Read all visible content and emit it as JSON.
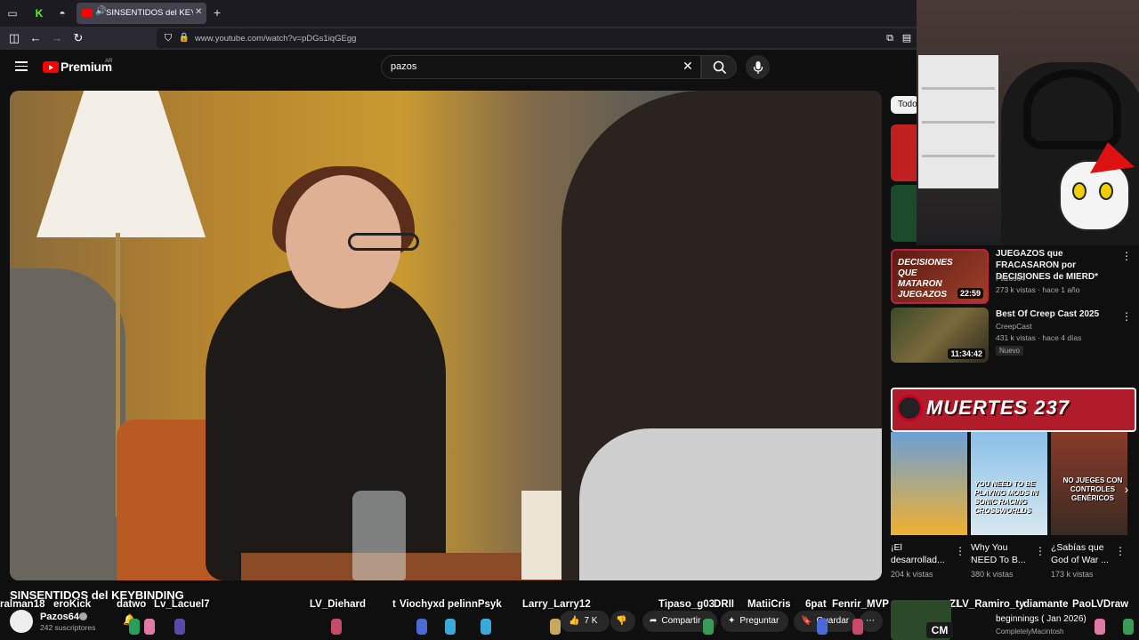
{
  "browser": {
    "active_tab_title": "SINSENTIDOS del KEYBINDING",
    "url": "www.youtube.com/watch?v=pDGs1iqGEgg"
  },
  "youtube": {
    "brand": "Premium",
    "region": "AR",
    "search_value": "pazos"
  },
  "video": {
    "title": "SINSENTIDOS del KEYBINDING",
    "channel": "Pazos64",
    "subscribers": "242 suscriptores",
    "likes": "7 K",
    "share_label": "Compartir",
    "ask_label": "Preguntar",
    "save_label": "Guardar"
  },
  "overlay_names": [
    "ralman18",
    "eroKick",
    "datwo",
    "Lv_Lacuel7",
    "LV_Diehard",
    "t",
    "Viochyxd",
    "pelinnPsyk",
    "Larry_Larry12",
    "Tipaso_g03",
    "DRII",
    "MatiiCris",
    "6pat",
    "Fenrir_MVP",
    "ZL",
    "LV_Ramiro_ty",
    "diamante",
    "PaoLVDraw"
  ],
  "sidebar": {
    "chip_label": "Todo",
    "recs": [
      {
        "title": "JUEGAZOS que FRACASARON por DECISIONES de MIERD*",
        "channel": "Pazos64",
        "meta": "273 k vistas · hace 1 año",
        "duration": "22:59",
        "thumb_text": "DECISIONES QUE MATARON JUEGAZOS"
      },
      {
        "title": "Best Of Creep Cast 2025",
        "channel": "CreepCast",
        "meta": "431 k vistas · hace 4 días",
        "duration": "11:34:42",
        "badge": "Nuevo"
      }
    ],
    "shelf": {
      "banner_text": "MUERTES 237",
      "cards": [
        {
          "title": "¡El desarrollad...",
          "views": "204 k vistas"
        },
        {
          "title": "Why You NEED To B...",
          "views": "380 k vistas",
          "thumb_text": "YOU NEED TO BE PLAYING MODS IN SONIC RACING CROSSWORLDS"
        },
        {
          "title": "¿Sabías que God of War ...",
          "views": "173 k vistas",
          "thumb_text": "NO JUEGES CON CONTROLES GENÉRICOS"
        }
      ]
    },
    "bottom": {
      "title": "beginnings ( Jan 2026)",
      "channel": "CompletelyMacintosh",
      "thumb_text": "CM"
    }
  },
  "colors": {
    "yt_red": "#ff0000",
    "bg": "#0f0f0f",
    "banner_red": "#b01c2a"
  }
}
